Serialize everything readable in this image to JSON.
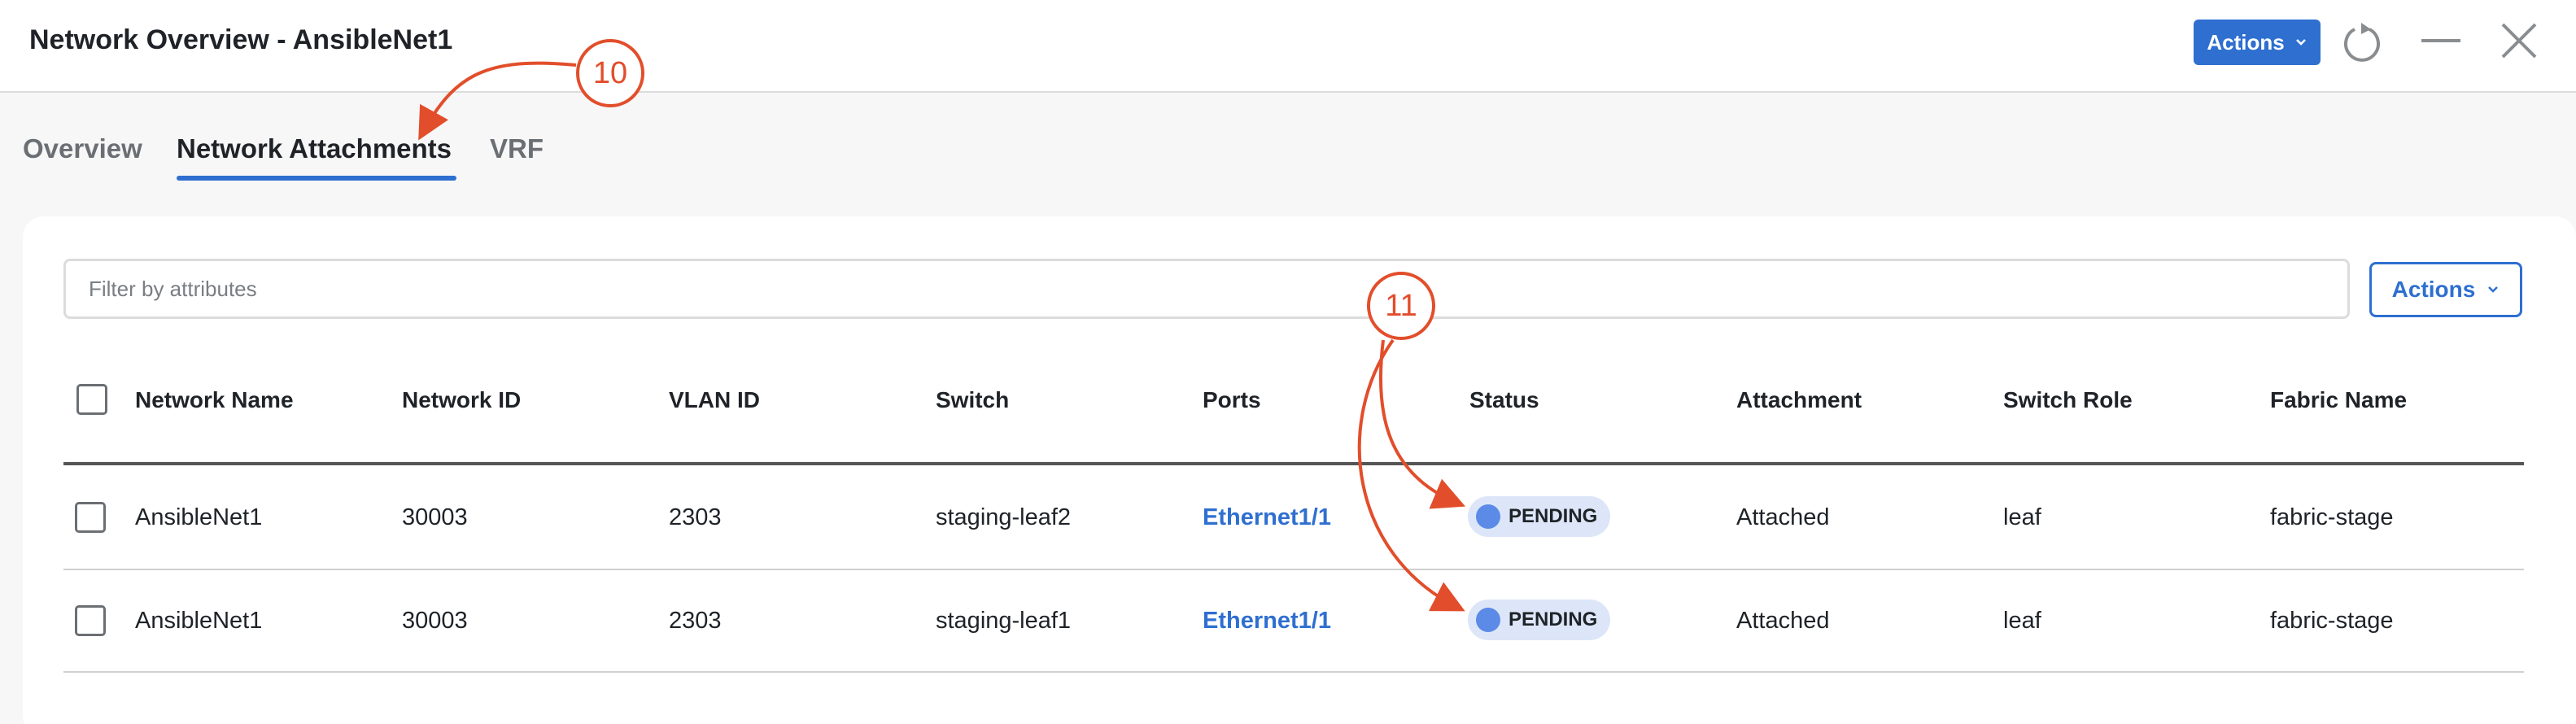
{
  "header": {
    "title": "Network Overview - AnsibleNet1",
    "actions_label": "Actions"
  },
  "tabs": [
    {
      "label": "Overview",
      "active": false
    },
    {
      "label": "Network Attachments",
      "active": true
    },
    {
      "label": "VRF",
      "active": false
    }
  ],
  "filter": {
    "placeholder": "Filter by attributes",
    "value": ""
  },
  "panel": {
    "actions_label": "Actions"
  },
  "table": {
    "columns": [
      "Network Name",
      "Network ID",
      "VLAN ID",
      "Switch",
      "Ports",
      "Status",
      "Attachment",
      "Switch Role",
      "Fabric Name"
    ],
    "rows": [
      {
        "network_name": "AnsibleNet1",
        "network_id": "30003",
        "vlan_id": "2303",
        "switch": "staging-leaf2",
        "ports": "Ethernet1/1",
        "status": "PENDING",
        "attachment": "Attached",
        "switch_role": "leaf",
        "fabric_name": "fabric-stage"
      },
      {
        "network_name": "AnsibleNet1",
        "network_id": "30003",
        "vlan_id": "2303",
        "switch": "staging-leaf1",
        "ports": "Ethernet1/1",
        "status": "PENDING",
        "attachment": "Attached",
        "switch_role": "leaf",
        "fabric_name": "fabric-stage"
      }
    ]
  },
  "annotations": [
    {
      "label": "10"
    },
    {
      "label": "11"
    }
  ],
  "colors": {
    "accent": "#2e6fd0",
    "annotation": "#e24e2b",
    "status_badge_bg": "#dce6f8",
    "status_dot": "#5b8be6"
  },
  "icons": [
    "chevron-down-icon",
    "refresh-icon",
    "minimize-icon",
    "close-icon"
  ]
}
